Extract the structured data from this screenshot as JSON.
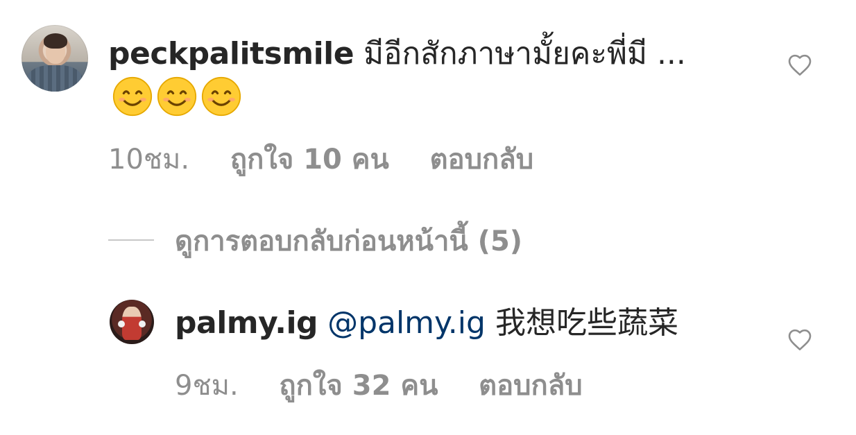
{
  "comments": [
    {
      "username": "peckpalitsmile",
      "text": "มีอีกสักภาษามั้ยคะพี่มี ...",
      "emoji": "😊",
      "emoji_count": 3,
      "time": "10ชม.",
      "likes": "ถูกใจ 10 คน",
      "reply_label": "ตอบกลับ",
      "like_icon": "heart-outline-icon"
    },
    {
      "username": "palmy.ig",
      "mention": "@palmy.ig",
      "text": "我想吃些蔬菜",
      "time": "9ชม.",
      "likes": "ถูกใจ 32 คน",
      "reply_label": "ตอบกลับ",
      "like_icon": "heart-outline-icon"
    }
  ],
  "view_replies": {
    "label": "ดูการตอบกลับก่อนหน้านี้ (5)"
  },
  "colors": {
    "text": "#262626",
    "muted": "#8e8e8e",
    "mention": "#003569",
    "divider": "#c7c7c7"
  }
}
